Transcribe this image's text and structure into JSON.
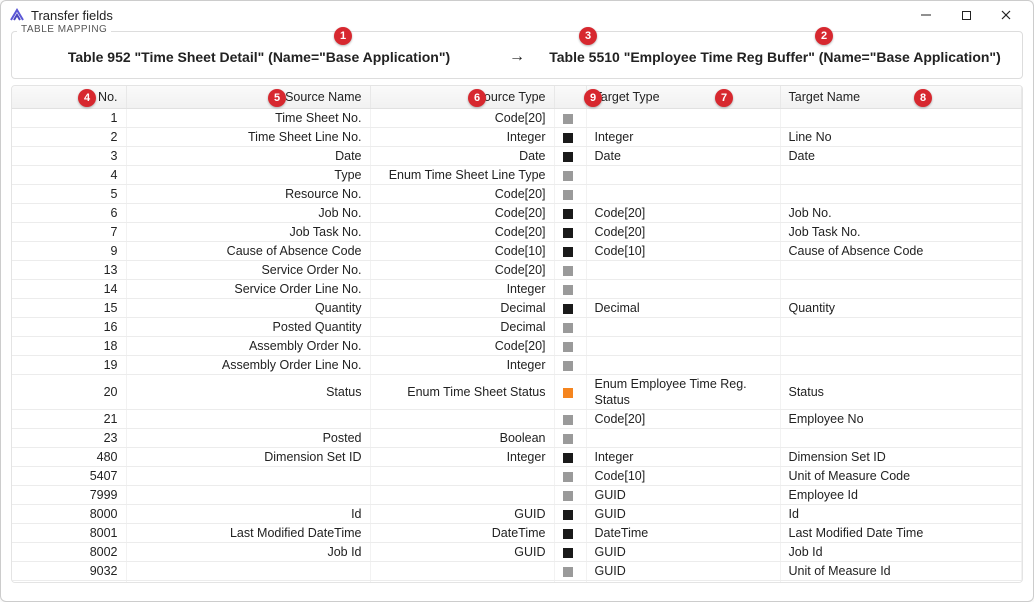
{
  "window": {
    "title": "Transfer fields"
  },
  "mapping": {
    "group_label": "TABLE MAPPING",
    "source_table": "Table 952 \"Time Sheet Detail\" (Name=\"Base Application\")",
    "arrow": "→",
    "target_table": "Table 5510 \"Employee Time Reg Buffer\" (Name=\"Base Application\")"
  },
  "columns": {
    "no": "No.",
    "source_name": "Source Name",
    "source_type": "Source Type",
    "match": "",
    "target_type": "Target Type",
    "target_name": "Target Name"
  },
  "match_colors": {
    "black": "#1a1a1a",
    "gray": "#9a9a9a",
    "orange": "#f5851f"
  },
  "rows": [
    {
      "no": "1",
      "sname": "Time Sheet No.",
      "stype": "Code[20]",
      "match": "gray",
      "ttype": "",
      "tname": ""
    },
    {
      "no": "2",
      "sname": "Time Sheet Line No.",
      "stype": "Integer",
      "match": "black",
      "ttype": "Integer",
      "tname": "Line No"
    },
    {
      "no": "3",
      "sname": "Date",
      "stype": "Date",
      "match": "black",
      "ttype": "Date",
      "tname": "Date"
    },
    {
      "no": "4",
      "sname": "Type",
      "stype": "Enum Time Sheet Line Type",
      "match": "gray",
      "ttype": "",
      "tname": ""
    },
    {
      "no": "5",
      "sname": "Resource No.",
      "stype": "Code[20]",
      "match": "gray",
      "ttype": "",
      "tname": ""
    },
    {
      "no": "6",
      "sname": "Job No.",
      "stype": "Code[20]",
      "match": "black",
      "ttype": "Code[20]",
      "tname": "Job No."
    },
    {
      "no": "7",
      "sname": "Job Task No.",
      "stype": "Code[20]",
      "match": "black",
      "ttype": "Code[20]",
      "tname": "Job Task No."
    },
    {
      "no": "9",
      "sname": "Cause of Absence Code",
      "stype": "Code[10]",
      "match": "black",
      "ttype": "Code[10]",
      "tname": "Cause of Absence Code"
    },
    {
      "no": "13",
      "sname": "Service Order No.",
      "stype": "Code[20]",
      "match": "gray",
      "ttype": "",
      "tname": ""
    },
    {
      "no": "14",
      "sname": "Service Order Line No.",
      "stype": "Integer",
      "match": "gray",
      "ttype": "",
      "tname": ""
    },
    {
      "no": "15",
      "sname": "Quantity",
      "stype": "Decimal",
      "match": "black",
      "ttype": "Decimal",
      "tname": "Quantity"
    },
    {
      "no": "16",
      "sname": "Posted Quantity",
      "stype": "Decimal",
      "match": "gray",
      "ttype": "",
      "tname": ""
    },
    {
      "no": "18",
      "sname": "Assembly Order No.",
      "stype": "Code[20]",
      "match": "gray",
      "ttype": "",
      "tname": ""
    },
    {
      "no": "19",
      "sname": "Assembly Order Line No.",
      "stype": "Integer",
      "match": "gray",
      "ttype": "",
      "tname": ""
    },
    {
      "no": "20",
      "sname": "Status",
      "stype": "Enum Time Sheet Status",
      "match": "orange",
      "ttype": "Enum Employee Time Reg. Status",
      "tname": "Status"
    },
    {
      "no": "21",
      "sname": "",
      "stype": "",
      "match": "gray",
      "ttype": "Code[20]",
      "tname": "Employee No"
    },
    {
      "no": "23",
      "sname": "Posted",
      "stype": "Boolean",
      "match": "gray",
      "ttype": "",
      "tname": ""
    },
    {
      "no": "480",
      "sname": "Dimension Set ID",
      "stype": "Integer",
      "match": "black",
      "ttype": "Integer",
      "tname": "Dimension Set ID"
    },
    {
      "no": "5407",
      "sname": "",
      "stype": "",
      "match": "gray",
      "ttype": "Code[10]",
      "tname": "Unit of Measure Code"
    },
    {
      "no": "7999",
      "sname": "",
      "stype": "",
      "match": "gray",
      "ttype": "GUID",
      "tname": "Employee Id"
    },
    {
      "no": "8000",
      "sname": "Id",
      "stype": "GUID",
      "match": "black",
      "ttype": "GUID",
      "tname": "Id"
    },
    {
      "no": "8001",
      "sname": "Last Modified DateTime",
      "stype": "DateTime",
      "match": "black",
      "ttype": "DateTime",
      "tname": "Last Modified Date Time"
    },
    {
      "no": "8002",
      "sname": "Job Id",
      "stype": "GUID",
      "match": "black",
      "ttype": "GUID",
      "tname": "Job Id"
    },
    {
      "no": "9032",
      "sname": "",
      "stype": "",
      "match": "gray",
      "ttype": "GUID",
      "tname": "Unit of Measure Id"
    }
  ],
  "callouts": {
    "1": "1",
    "2": "2",
    "3": "3",
    "4": "4",
    "5": "5",
    "6": "6",
    "7": "7",
    "8": "8",
    "9": "9"
  }
}
